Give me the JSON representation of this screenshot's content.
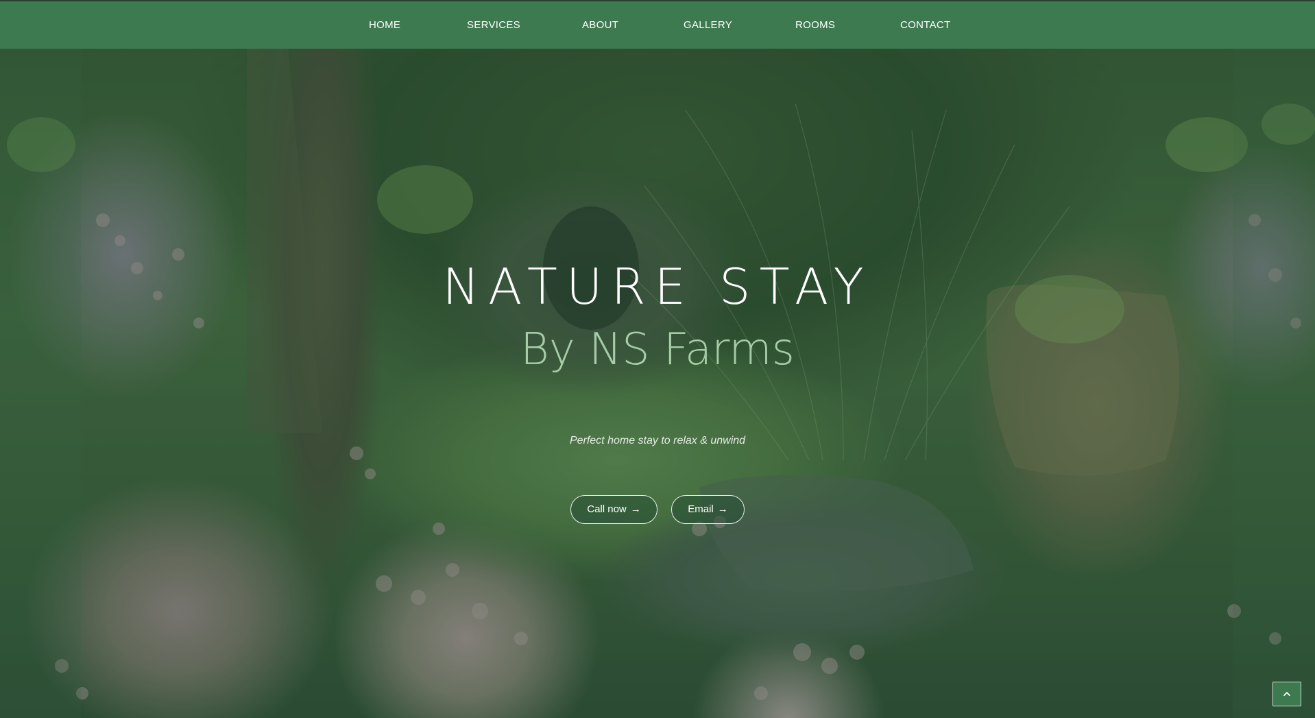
{
  "nav": {
    "items": [
      {
        "label": "HOME"
      },
      {
        "label": "SERVICES"
      },
      {
        "label": "ABOUT"
      },
      {
        "label": "GALLERY"
      },
      {
        "label": "ROOMS"
      },
      {
        "label": "CONTACT"
      }
    ]
  },
  "hero": {
    "title": "NATURE STAY",
    "subtitle": "By NS Farms",
    "tagline": "Perfect home stay to relax & unwind",
    "background_image": "garden-scene",
    "buttons": {
      "call_label": "Call now",
      "email_label": "Email",
      "arrow_icon": "arrow-right-icon"
    }
  },
  "back_to_top": {
    "icon": "chevron-up-icon"
  },
  "colors": {
    "nav_background": "#3e7a50",
    "overlay": "#264e34",
    "text": "#ffffff"
  }
}
